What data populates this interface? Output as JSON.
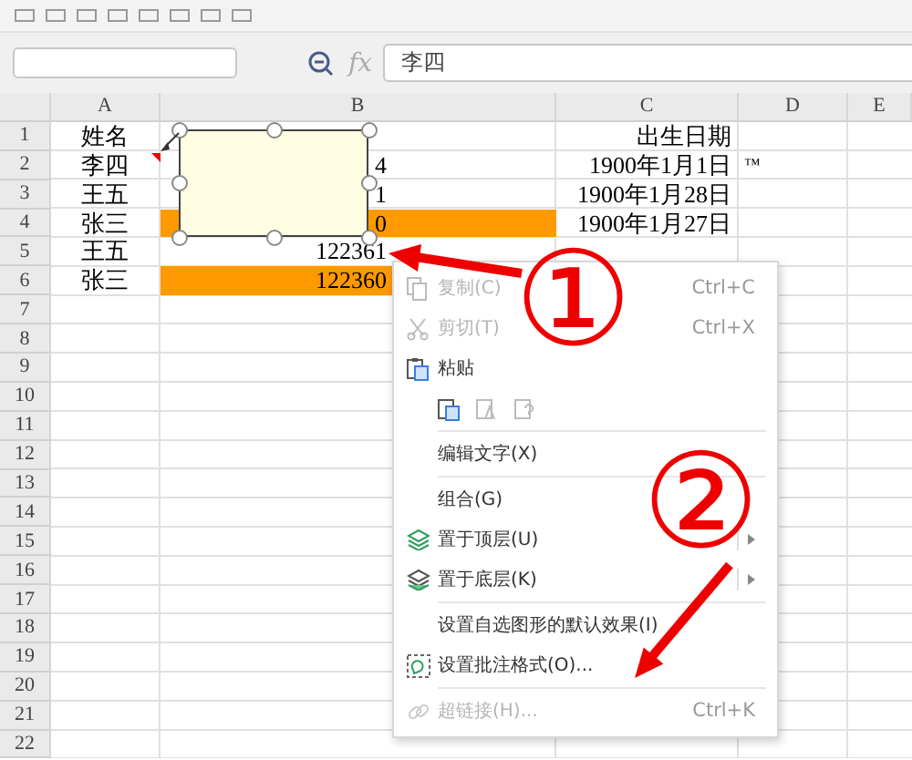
{
  "formula_bar": {
    "fx_label": "fx",
    "value": "李四"
  },
  "columns": [
    "A",
    "B",
    "C",
    "D",
    "E"
  ],
  "rows": [
    {
      "number": "1",
      "highlighted": false,
      "A": "姓名",
      "C": "出生日期"
    },
    {
      "number": "2",
      "highlighted": false,
      "A": "李四",
      "B": "4",
      "C": "1900年1月1日",
      "D": "™"
    },
    {
      "number": "3",
      "highlighted": false,
      "A": "王五",
      "B": "1",
      "C": "1900年1月28日"
    },
    {
      "number": "4",
      "highlighted": true,
      "A": "张三",
      "B": "0",
      "C": "1900年1月27日"
    },
    {
      "number": "5",
      "highlighted": false,
      "A": "王五",
      "B": "122361"
    },
    {
      "number": "6",
      "highlighted": true,
      "A": "张三",
      "B": "122360"
    },
    {
      "number": "7"
    },
    {
      "number": "8"
    },
    {
      "number": "9"
    },
    {
      "number": "10"
    },
    {
      "number": "11"
    },
    {
      "number": "12"
    },
    {
      "number": "13"
    },
    {
      "number": "14"
    },
    {
      "number": "15"
    },
    {
      "number": "16"
    },
    {
      "number": "17"
    },
    {
      "number": "18"
    },
    {
      "number": "19"
    },
    {
      "number": "20"
    },
    {
      "number": "21"
    },
    {
      "number": "22"
    }
  ],
  "comment_box": {
    "selected": true
  },
  "context_menu": [
    {
      "kind": "item",
      "label": "复制(C)",
      "shortcut": "Ctrl+C",
      "disabled": true
    },
    {
      "kind": "item",
      "label": "剪切(T)",
      "shortcut": "Ctrl+X",
      "disabled": true
    },
    {
      "kind": "item",
      "label": "粘贴",
      "disabled": false
    },
    {
      "kind": "paste_options"
    },
    {
      "kind": "separator"
    },
    {
      "kind": "item",
      "label": "编辑文字(X)",
      "disabled": false
    },
    {
      "kind": "separator"
    },
    {
      "kind": "item",
      "label": "组合(G)",
      "disabled": false
    },
    {
      "kind": "item",
      "label": "置于顶层(U)",
      "disabled": false,
      "submenu": true
    },
    {
      "kind": "item",
      "label": "置于底层(K)",
      "disabled": false,
      "submenu": true
    },
    {
      "kind": "separator"
    },
    {
      "kind": "item",
      "label": "设置自选图形的默认效果(I)",
      "disabled": false
    },
    {
      "kind": "item",
      "label": "设置批注格式(O)...",
      "disabled": false
    },
    {
      "kind": "separator"
    },
    {
      "kind": "item",
      "label": "超链接(H)...",
      "shortcut": "Ctrl+K",
      "disabled": true
    }
  ],
  "annotations": [
    {
      "label": "①"
    },
    {
      "label": "②"
    }
  ]
}
